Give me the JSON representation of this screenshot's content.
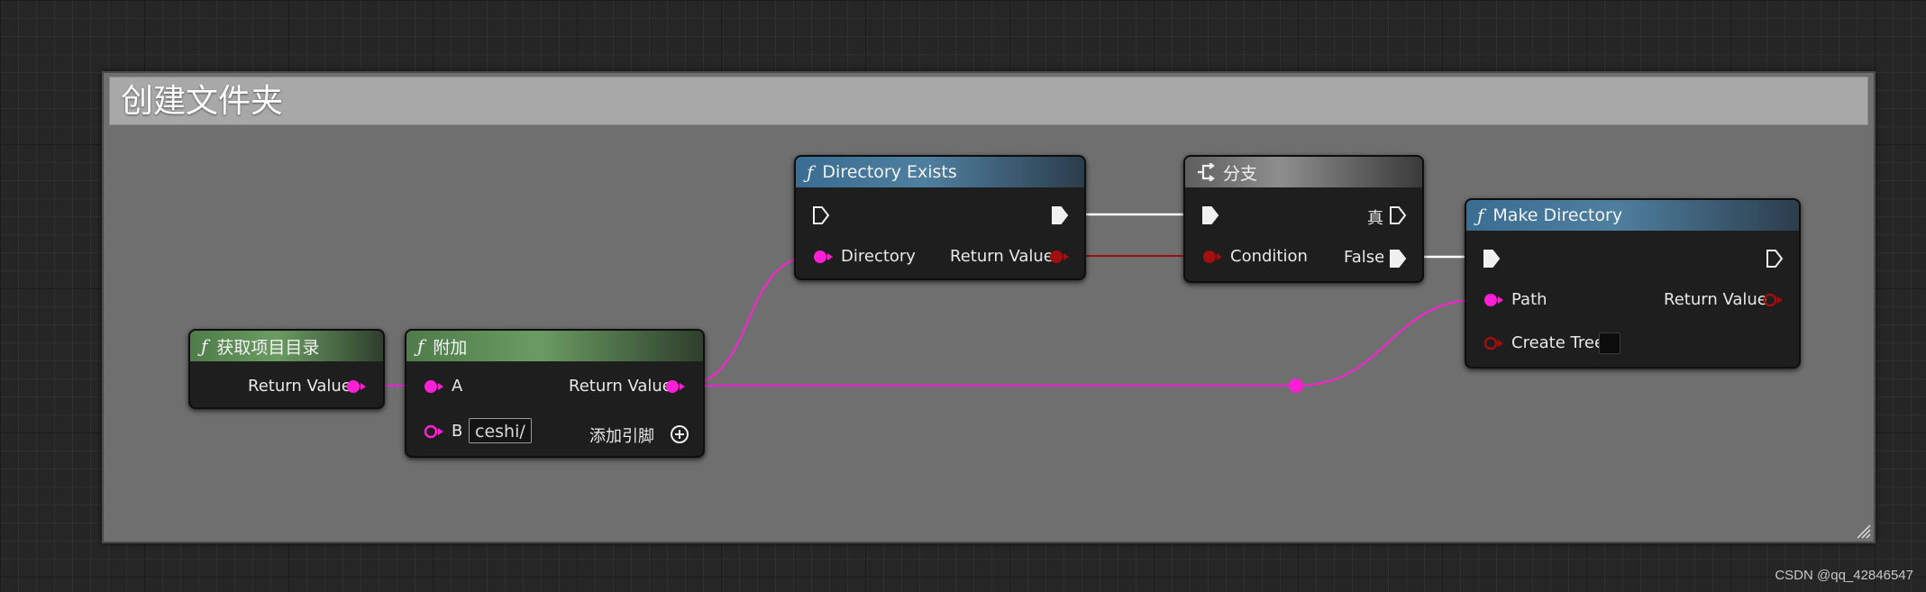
{
  "comment": {
    "title": "创建文件夹"
  },
  "nodes": {
    "get_project_dir": {
      "title": "获取项目目录",
      "return_value": "Return Value"
    },
    "append": {
      "title": "附加",
      "pin_a": "A",
      "pin_b": "B",
      "b_value": "ceshi/",
      "return_value": "Return Value",
      "add_pin": "添加引脚"
    },
    "directory_exists": {
      "title": "Directory Exists",
      "directory": "Directory",
      "return_value": "Return Value"
    },
    "branch": {
      "title": "分支",
      "true_label": "真",
      "condition": "Condition",
      "false_label": "False"
    },
    "make_directory": {
      "title": "Make Directory",
      "path": "Path",
      "return_value": "Return Value",
      "create_tree": "Create Tree"
    }
  },
  "colors": {
    "string_pin": "#ff1fd4",
    "bool_pin": "#8b0000",
    "exec_wire": "#ffffff"
  },
  "watermark": "CSDN @qq_42846547"
}
